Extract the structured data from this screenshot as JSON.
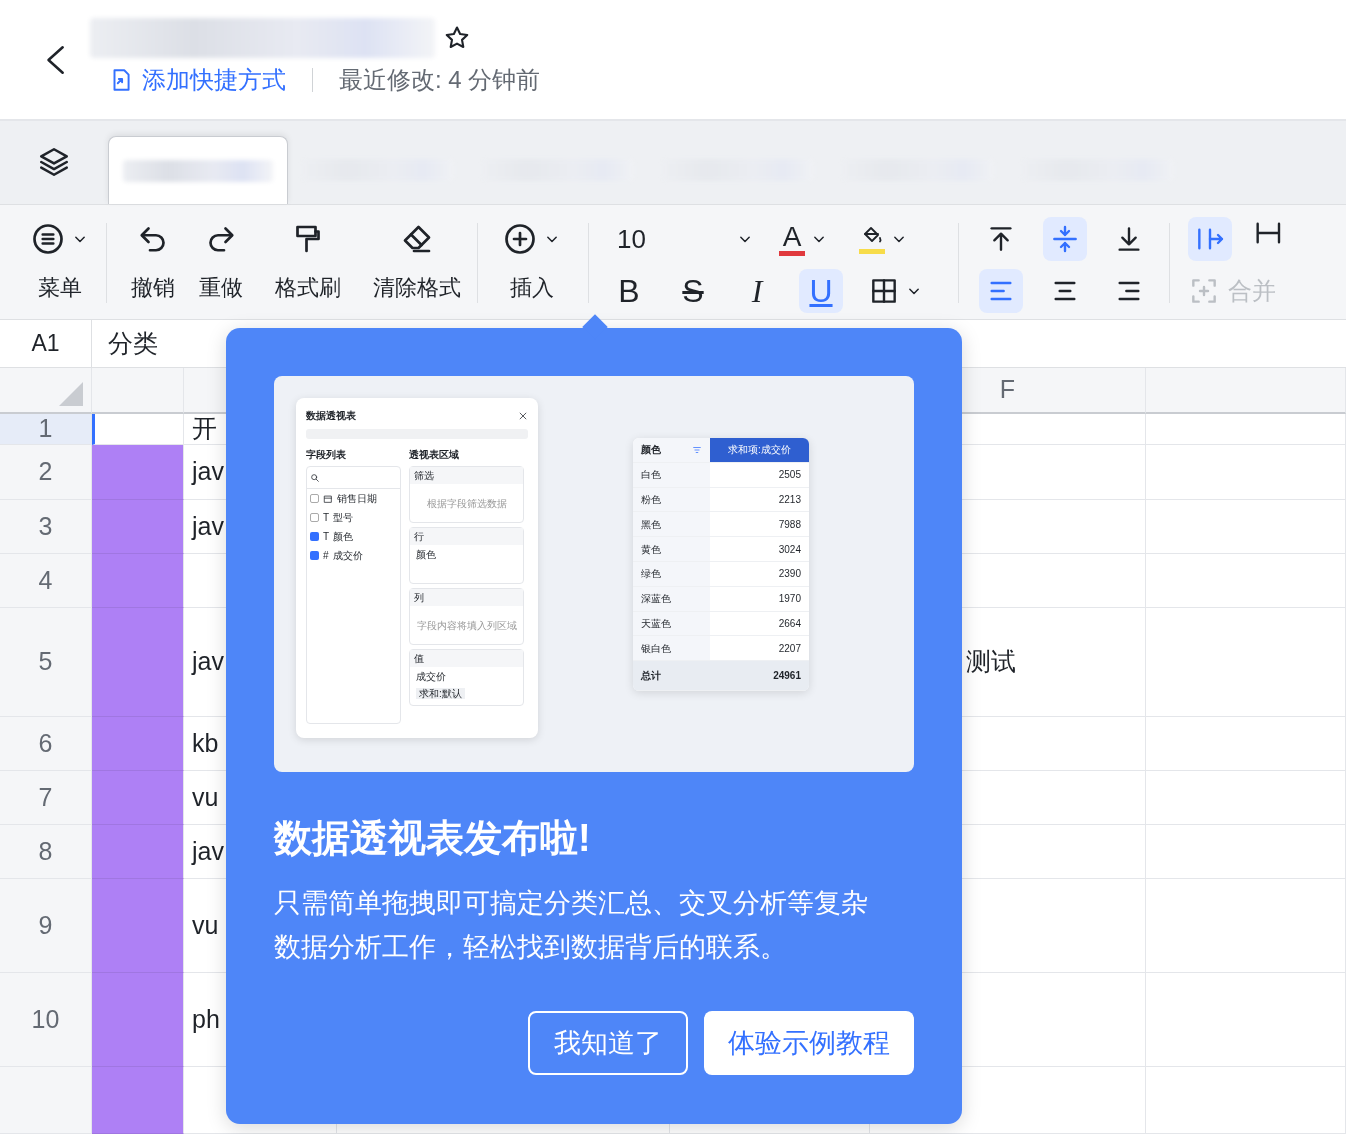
{
  "header": {
    "starred": false,
    "shortcut_link": "添加快捷方式",
    "last_modified": "最近修改: 4 分钟前"
  },
  "sheet_tabs": [
    {
      "selected": true
    },
    {
      "selected": false
    },
    {
      "selected": false
    },
    {
      "selected": false
    },
    {
      "selected": false
    },
    {
      "selected": false
    }
  ],
  "toolbar": {
    "main": [
      {
        "label": "菜单",
        "dropdown": true
      },
      {
        "label": "撤销",
        "dropdown": false
      },
      {
        "label": "重做",
        "dropdown": false
      },
      {
        "label": "格式刷",
        "dropdown": false
      },
      {
        "label": "清除格式",
        "dropdown": false
      },
      {
        "label": "插入",
        "dropdown": true
      }
    ],
    "font_size": "10",
    "font_color": {
      "glyph": "A",
      "color": "#e0393e"
    },
    "fill_color": {
      "color": "#f7dc4a"
    },
    "text_style": [
      {
        "glyph": "B",
        "selected": false
      },
      {
        "glyph": "S",
        "selected": false
      },
      {
        "glyph": "I",
        "selected": false
      },
      {
        "glyph": "U",
        "selected": true
      }
    ],
    "vertical_align": [
      {
        "selected": false
      },
      {
        "selected": true
      },
      {
        "selected": false
      }
    ],
    "horizontal_align": [
      {
        "selected": true
      },
      {
        "selected": false
      },
      {
        "selected": false
      }
    ],
    "wrap": {
      "selected": true
    },
    "merge": {
      "label": "合并",
      "disabled": true
    }
  },
  "grid": {
    "name_box": "A1",
    "formula": "分类",
    "column_header": "F",
    "rows": [
      {
        "number": "1",
        "selected": true,
        "column_b": "开"
      },
      {
        "number": "2",
        "selected": false,
        "color": "#ae80f5",
        "column_b": "jav"
      },
      {
        "number": "3",
        "selected": false,
        "color": "#ae80f5",
        "column_b": "jav"
      },
      {
        "number": "4",
        "selected": false,
        "color": "#ae80f5"
      },
      {
        "number": "5",
        "selected": false,
        "color": "#ae80f5",
        "column_b": "jav",
        "column_f": "测试"
      },
      {
        "number": "6",
        "selected": false,
        "color": "#ae80f5",
        "column_b": "kb"
      },
      {
        "number": "7",
        "selected": false,
        "color": "#ae80f5",
        "column_b": "vu"
      },
      {
        "number": "8",
        "selected": false,
        "color": "#ae80f5",
        "column_b": "jav"
      },
      {
        "number": "9",
        "selected": false,
        "color": "#ae80f5",
        "column_b": "vu"
      },
      {
        "number": "10",
        "selected": false,
        "color": "#ae80f5",
        "column_b": "ph"
      },
      {
        "selected": false,
        "color": "#ae80f5"
      }
    ]
  },
  "popup": {
    "preview": {
      "panel_title": "数据透视表",
      "field_list_title": "字段列表",
      "area_title": "透视表区域",
      "fields": [
        {
          "kind": "date",
          "name": "销售日期",
          "checked": false
        },
        {
          "kind": "text",
          "glyph": "T",
          "name": "型号",
          "checked": false
        },
        {
          "kind": "text",
          "glyph": "T",
          "name": "颜色",
          "checked": true
        },
        {
          "kind": "number",
          "glyph": "#",
          "name": "成交价",
          "checked": true
        }
      ],
      "areas": [
        {
          "title": "筛选",
          "hint": "根据字段筛选数据"
        },
        {
          "title": "行",
          "field": "颜色"
        },
        {
          "title": "列",
          "hint": "字段内容将填入列区域"
        },
        {
          "title": "值",
          "field": "成交价",
          "tag": "求和:默认"
        }
      ],
      "table": {
        "columns": [
          "颜色",
          "求和项:成交价"
        ],
        "rows": [
          {
            "label": "白色",
            "value": "2505"
          },
          {
            "label": "粉色",
            "value": "2213"
          },
          {
            "label": "黑色",
            "value": "7988"
          },
          {
            "label": "黄色",
            "value": "3024"
          },
          {
            "label": "绿色",
            "value": "2390"
          },
          {
            "label": "深蓝色",
            "value": "1970"
          },
          {
            "label": "天蓝色",
            "value": "2664"
          },
          {
            "label": "银白色",
            "value": "2207"
          }
        ],
        "total": {
          "label": "总计",
          "value": "24961"
        }
      }
    },
    "title": "数据透视表发布啦!",
    "description": "只需简单拖拽即可搞定分类汇总、交叉分析等复杂数据分析工作，轻松找到数据背后的联系。",
    "buttons": [
      {
        "label": "我知道了",
        "kind": "secondary"
      },
      {
        "label": "体验示例教程",
        "kind": "primary"
      }
    ]
  }
}
